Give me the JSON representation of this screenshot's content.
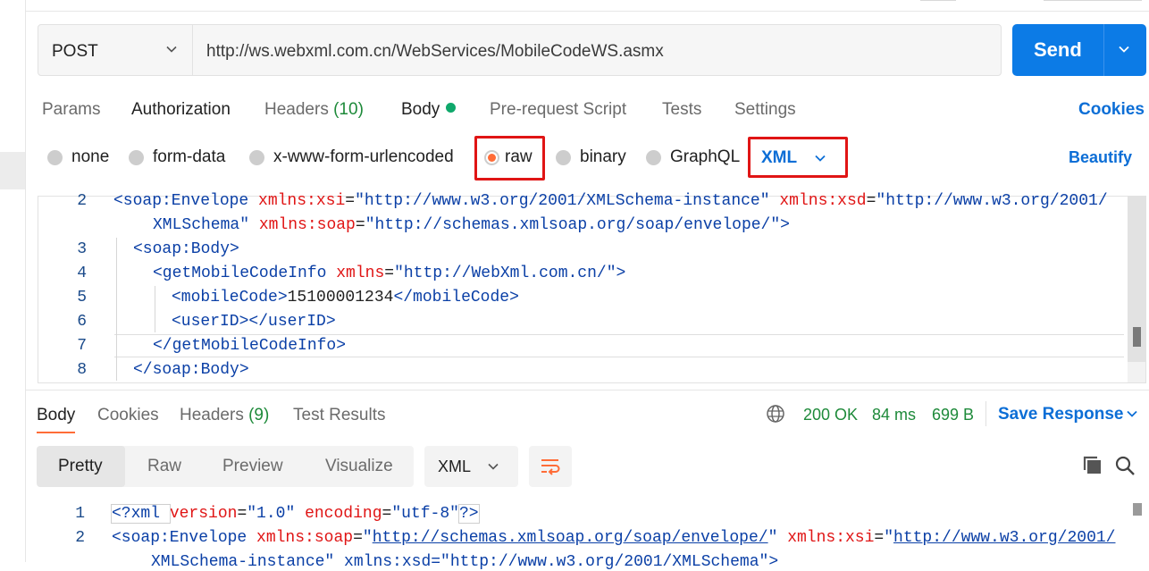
{
  "request": {
    "method": "POST",
    "url": "http://ws.webxml.com.cn/WebServices/MobileCodeWS.asmx",
    "send_label": "Send"
  },
  "request_tabs": {
    "params": "Params",
    "authorization": "Authorization",
    "headers": "Headers",
    "headers_count": "(10)",
    "body": "Body",
    "prerequest": "Pre-request Script",
    "tests": "Tests",
    "settings": "Settings",
    "cookies": "Cookies"
  },
  "body_types": {
    "none": "none",
    "form_data": "form-data",
    "urlencoded": "x-www-form-urlencoded",
    "raw": "raw",
    "binary": "binary",
    "graphql": "GraphQL",
    "language": "XML",
    "beautify": "Beautify",
    "selected": "raw"
  },
  "request_editor": {
    "line_numbers": [
      "2",
      "",
      "3",
      "4",
      "5",
      "6",
      "7",
      "8"
    ],
    "line2a": {
      "open": "<soap:Envelope ",
      "attr1": "xmlns:xsi",
      "eq1": "=",
      "val1": "\"http://www.w3.org/2001/XMLSchema-instance\"",
      "attr2": "xmlns:xsd",
      "eq2": "=",
      "val2": "\"http://www.w3.org/2001/"
    },
    "line2b": {
      "val2_cont": "XMLSchema\"",
      "attr3": "xmlns:soap",
      "eq3": "=",
      "val3": "\"http://schemas.xmlsoap.org/soap/envelope/\"",
      "close": ">"
    },
    "line3": "<soap:Body>",
    "line4": {
      "open": "<getMobileCodeInfo ",
      "attr": "xmlns",
      "eq": "=",
      "val": "\"http://WebXml.com.cn/\"",
      "close": ">"
    },
    "line5": {
      "open": "<mobileCode>",
      "text": "15100001234",
      "close": "</mobileCode>"
    },
    "line6": "<userID></userID>",
    "line7": "</getMobileCodeInfo>",
    "line8": "</soap:Body>"
  },
  "response_tabs": {
    "body": "Body",
    "cookies": "Cookies",
    "headers": "Headers",
    "headers_count": "(9)",
    "test_results": "Test Results"
  },
  "response_status": {
    "status": "200 OK",
    "time": "84 ms",
    "size": "699 B",
    "save_response": "Save Response"
  },
  "response_view": {
    "pretty": "Pretty",
    "raw": "Raw",
    "preview": "Preview",
    "visualize": "Visualize",
    "language": "XML",
    "selected": "Pretty"
  },
  "response_editor": {
    "line_numbers": [
      "1",
      "2"
    ],
    "line1": {
      "open": "<?xml ",
      "attr1": "version",
      "eq1": "=",
      "val1": "\"1.0\"",
      "attr2": "encoding",
      "eq2": "=",
      "val2": "\"utf-8\"",
      "close": "?>"
    },
    "line2": {
      "open": "<soap:Envelope ",
      "attr1": "xmlns:soap",
      "eq1": "=",
      "val1_q": "\"",
      "val1_url": "http://schemas.xmlsoap.org/soap/envelope/",
      "val1_q2": "\"",
      "attr2": "xmlns:xsi",
      "eq2": "=",
      "val2_q": "\"",
      "val2_url": "http://www.w3.org/2001/"
    },
    "line3_partial": "XMLSchema-instance\" xmlns:xsd=\"http://www.w3.org/2001/XMLSchema\">"
  },
  "colors": {
    "accent_blue": "#0c7be6",
    "link_blue": "#0c6ed6",
    "success_green": "#1e8a3a",
    "active_orange": "#ff6c37",
    "highlight_red": "#e01515"
  }
}
